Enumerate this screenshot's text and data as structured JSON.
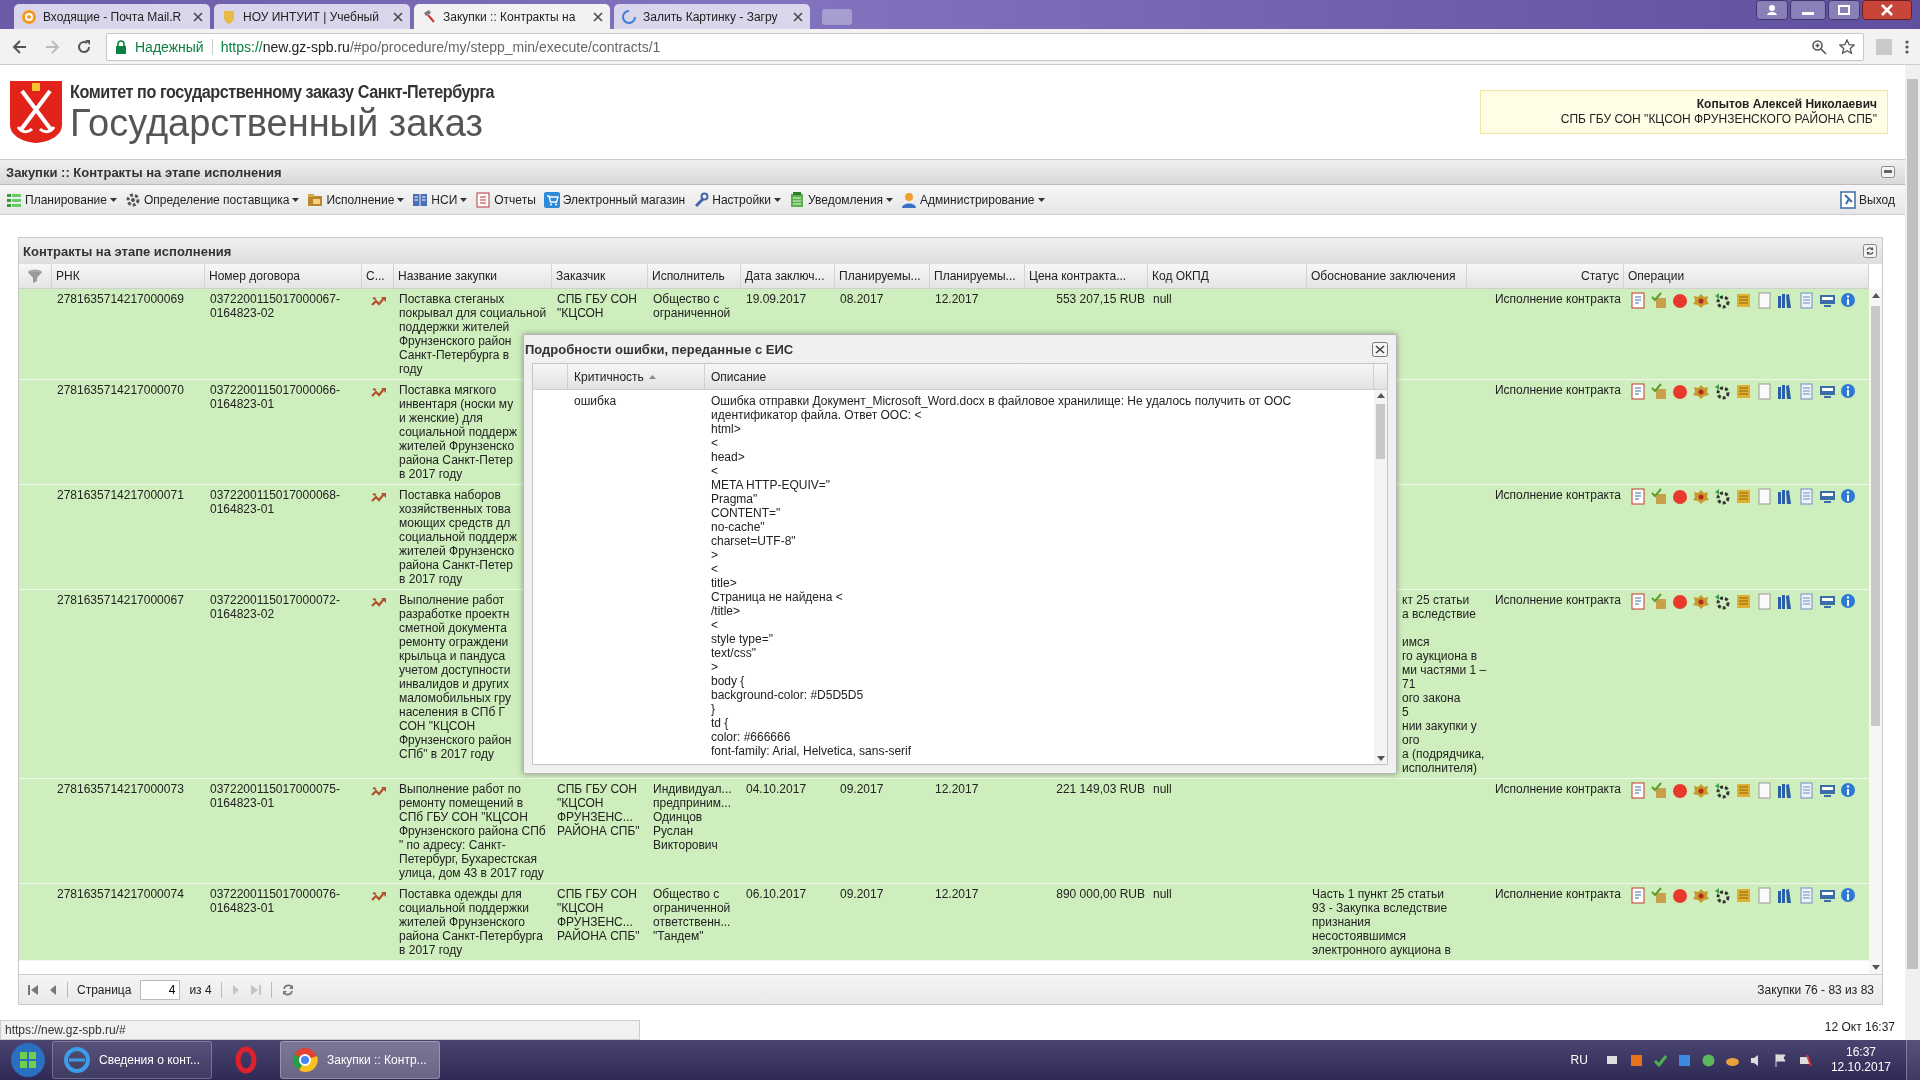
{
  "browser": {
    "tabs": [
      {
        "title": "Входящие - Почта Mail.R",
        "selected": false
      },
      {
        "title": "НОУ ИНТУИТ | Учебный",
        "selected": false
      },
      {
        "title": "Закупки :: Контракты на",
        "selected": true
      },
      {
        "title": "Залить Картинку - Загру",
        "selected": false
      }
    ],
    "security_label": "Надежный",
    "url_scheme": "https://",
    "url_host": "new.gz-spb.ru",
    "url_path": "/#po/procedure/my/stepp_min/execute/contracts/1"
  },
  "header": {
    "subtitle": "Комитет по государственному заказу Санкт-Петербурга",
    "title": "Государственный заказ",
    "user_name": "Копытов Алексей Николаевич",
    "user_org": "СПБ ГБУ СОН \"КЦСОН ФРУНЗЕНСКОГО РАЙОНА СПБ\""
  },
  "page_title": "Закупки :: Контракты на этапе исполнения",
  "menu": [
    {
      "label": "Планирование",
      "dropdown": true
    },
    {
      "label": "Определение поставщика",
      "dropdown": true
    },
    {
      "label": "Исполнение",
      "dropdown": true
    },
    {
      "label": "НСИ",
      "dropdown": true
    },
    {
      "label": "Отчеты",
      "dropdown": false
    },
    {
      "label": "Электронный магазин",
      "dropdown": false
    },
    {
      "label": "Настройки",
      "dropdown": true
    },
    {
      "label": "Уведомления",
      "dropdown": true
    },
    {
      "label": "Администрирование",
      "dropdown": true
    }
  ],
  "exit_label": "Выход",
  "grid": {
    "title": "Контракты на этапе исполнения",
    "columns": [
      "РНК",
      "Номер договора",
      "С...",
      "Название закупки",
      "Заказчик",
      "Исполнитель",
      "Дата заключ...",
      "Планируемы...",
      "Планируемы...",
      "Цена контракта...",
      "Код ОКПД",
      "Обоснование заключения",
      "Статус",
      "Операции"
    ],
    "rows": [
      {
        "rnk": "2781635714217000069",
        "number": "0372200115017000067-\n0164823-02",
        "name": "Поставка стеганых\nпокрывал для социальной\nподдержки жителей\nФрунзенского район\nСанкт-Петербурга в\nгоду",
        "customer": "СПБ ГБУ СОН\n\"КЦСОН",
        "supplier": "Общество с\nограниченной",
        "date": "19.09.2017",
        "plan_start": "08.2017",
        "plan_end": "12.2017",
        "price": "553 207,15 RUB",
        "okpd": "null",
        "status": "Исполнение контракта"
      },
      {
        "rnk": "2781635714217000070",
        "number": "0372200115017000066-\n0164823-01",
        "name": "Поставка мягкого\nинвентаря (носки му\nи женские) для\nсоциальной поддерж\nжителей Фрунзенско\nрайона Санкт-Петер\nв 2017 году",
        "status": "Исполнение контракта"
      },
      {
        "rnk": "2781635714217000071",
        "number": "0372200115017000068-\n0164823-01",
        "name": "Поставка наборов\nхозяйственных това\nмоющих средств дл\nсоциальной поддерж\nжителей Фрунзенско\nрайона Санкт-Петер\nв 2017 году",
        "status": "Исполнение контракта"
      },
      {
        "rnk": "2781635714217000067",
        "number": "0372200115017000072-\n0164823-02",
        "name": "Выполнение работ\nразработке проектн\nсметной документа\nремонту ограждени\nкрыльца и пандуса\nучетом доступности\nинвалидов и других\nмаломобильных гру\nнаселения в СПб Г\nСОН \"КЦСОН\nФрунзенского район\nСПб\" в 2017 году",
        "basis": "кт 25 статьи\nа вследствие\n\nимся\nго аукциона в\nми частями 1 –\n71\nого закона\n5\nнии закупки у\nого\nа (подрядчика,\nисполнителя)",
        "status": "Исполнение контракта"
      },
      {
        "rnk": "2781635714217000073",
        "number": "0372200115017000075-\n0164823-01",
        "name": "Выполнение работ по\nремонту помещений в\nСПб ГБУ СОН \"КЦСОН\nФрунзенского района СПб\n\" по адресу: Санкт-\nПетербург, Бухарестская\nулица, дом 43 в 2017 году",
        "customer": "СПБ ГБУ СОН\n\"КЦСОН\nФРУНЗЕНС...\nРАЙОНА СПБ\"",
        "supplier": "Индивидуал...\nпредприним...\nОдинцов\nРуслан\nВикторович",
        "date": "04.10.2017",
        "plan_start": "09.2017",
        "plan_end": "12.2017",
        "price": "221 149,03 RUB",
        "okpd": "null",
        "status": "Исполнение контракта"
      },
      {
        "rnk": "2781635714217000074",
        "number": "0372200115017000076-\n0164823-01",
        "name": "Поставка одежды для\nсоциальной поддержки\nжителей Фрунзенского\nрайона Санкт-Петербурга\nв 2017 году",
        "customer": "СПБ ГБУ СОН\n\"КЦСОН\nФРУНЗЕНС...\nРАЙОНА СПБ\"",
        "supplier": "Общество с\nограниченной\nответственн...\n\"Тандем\"",
        "date": "06.10.2017",
        "plan_start": "09.2017",
        "plan_end": "12.2017",
        "price": "890 000,00 RUB",
        "okpd": "null",
        "basis": "Часть 1 пункт 25 статьи\n93 - Закупка вследствие\nпризнания\nнесостоявшимся\nэлектронного аукциона в",
        "status": "Исполнение контракта"
      }
    ],
    "pager": {
      "page_label": "Страница",
      "page": "4",
      "of_label": "из 4",
      "summary": "Закупки 76 - 83 из 83"
    }
  },
  "dialog": {
    "title": "Подробности ошибки, переданные с ЕИС",
    "columns": [
      {
        "label": "Критичность",
        "sorted_ascending": true
      },
      {
        "label": "Описание",
        "sorted_ascending": false
      }
    ],
    "rows": [
      {
        "severity": "ошибка",
        "description": "Ошибка отправки Документ_Microsoft_Word.docx в файловое хранилище: Не удалось получить от ООС идентификатор файла. Ответ ООС: <\nhtml>\n<\nhead>\n<\nMETA HTTP-EQUIV=\"\nPragma\"\nCONTENT=\"\nno-cache\"\ncharset=UTF-8\"\n>\n<\ntitle>\nСтраница не найдена <\n/title>\n<\nstyle type=\"\ntext/css\"\n>\nbody {\nbackground-color: #D5D5D5\n}\ntd {\ncolor: #666666\nfont-family: Arial, Helvetica, sans-serif"
      }
    ]
  },
  "status_bar": {
    "link": "https://new.gz-spb.ru/#",
    "datetime": "12 Окт 16:37"
  },
  "taskbar": {
    "items": [
      {
        "kind": "window",
        "label": "Сведения о конт...",
        "selected": false
      },
      {
        "kind": "pinned",
        "selected": false
      },
      {
        "kind": "window",
        "label": "Закупки :: Контр...",
        "selected": true
      }
    ],
    "language": "RU",
    "time": "16:37",
    "date": "12.10.2017"
  }
}
